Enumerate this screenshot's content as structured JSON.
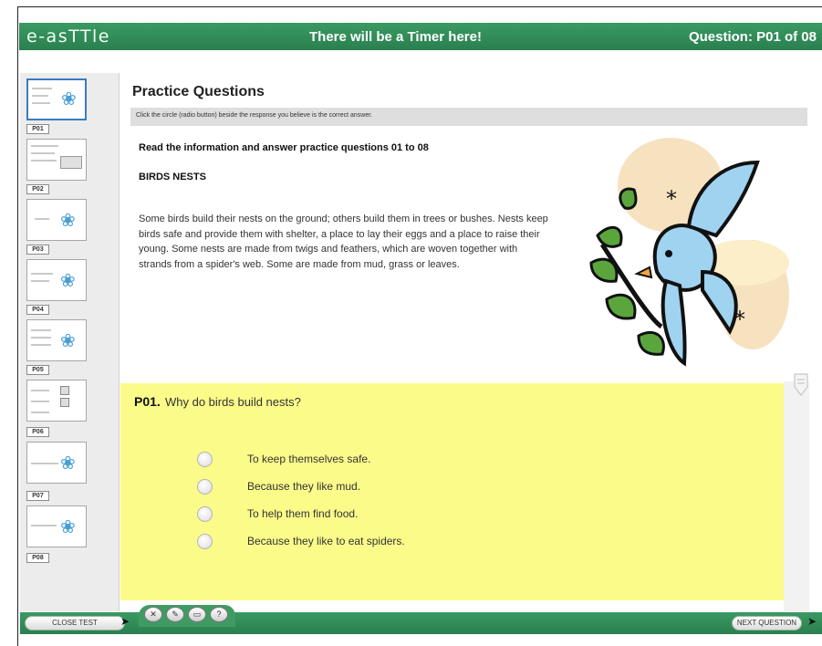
{
  "header": {
    "brand": "e-asTTle",
    "timer_text": "There will be a Timer here!",
    "question_counter": "Question: P01 of 08"
  },
  "sidebar": {
    "items": [
      {
        "label": "P01",
        "active": true
      },
      {
        "label": "P02",
        "active": false
      },
      {
        "label": "P03",
        "active": false
      },
      {
        "label": "P04",
        "active": false
      },
      {
        "label": "P05",
        "active": false
      },
      {
        "label": "P06",
        "active": false
      },
      {
        "label": "P07",
        "active": false
      },
      {
        "label": "P08",
        "active": false
      }
    ]
  },
  "main": {
    "title": "Practice Questions",
    "instruction": "Click the circle (radio button) beside the response you believe is the correct answer.",
    "read_prompt": "Read the information and answer practice questions 01 to 08",
    "passage_heading": "BIRDS NESTS",
    "passage": "Some birds build their nests on the ground; others build them in trees or bushes. Nests keep birds safe and provide them with shelter, a place to lay their eggs and a place to raise their young. Some nests are made from twigs and feathers, which are woven together with strands from a spider's web. Some are made from mud, grass or leaves."
  },
  "question": {
    "number": "P01.",
    "text": "Why do birds build nests?",
    "options": [
      "To keep themselves safe.",
      "Because they like mud.",
      "To help them find food.",
      "Because they like to eat spiders."
    ],
    "selected": null
  },
  "footer": {
    "close_label": "CLOSE TEST",
    "next_label": "NEXT QUESTION",
    "tools": [
      "x-icon",
      "pencil-icon",
      "eraser-icon",
      "help-icon"
    ]
  },
  "colors": {
    "bar_green": "#2e8b57",
    "question_bg": "#fbfb8a",
    "sidebar_bg": "#ececec",
    "instruction_bg": "#dedede"
  }
}
